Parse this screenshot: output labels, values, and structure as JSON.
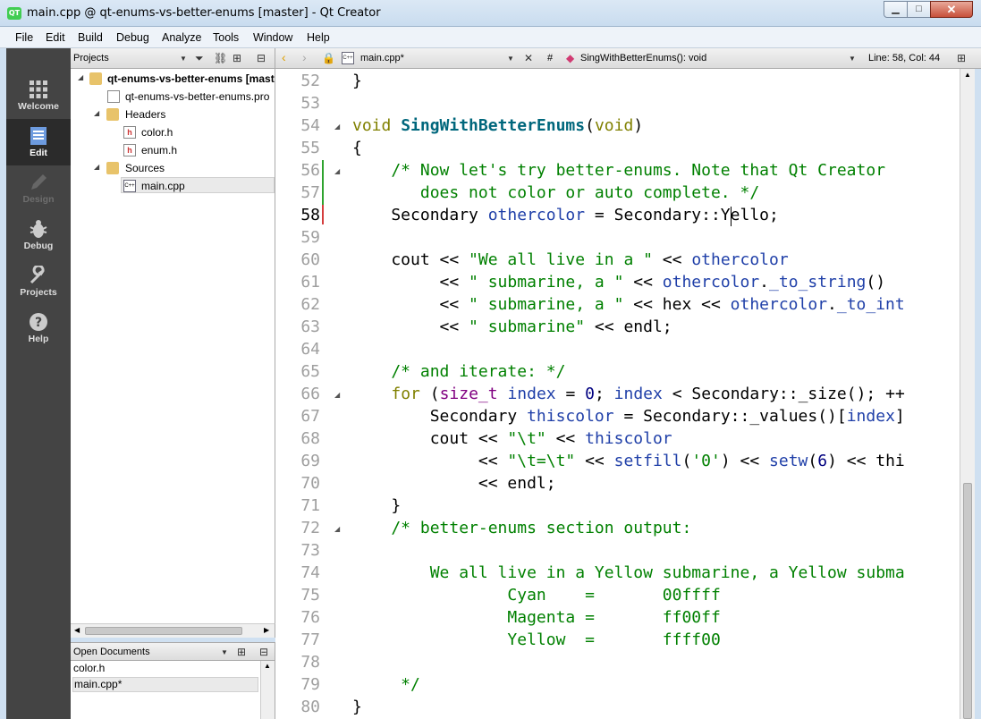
{
  "window": {
    "title": "main.cpp @ qt-enums-vs-better-enums [master] - Qt Creator",
    "app_icon": "QT",
    "controls": {
      "minimize": "▁",
      "maximize": "□",
      "close": "✕"
    }
  },
  "menu": [
    "File",
    "Edit",
    "Build",
    "Debug",
    "Analyze",
    "Tools",
    "Window",
    "Help"
  ],
  "modes": [
    {
      "label": "Welcome",
      "icon": "grid-icon"
    },
    {
      "label": "Edit",
      "icon": "document-icon",
      "active": true
    },
    {
      "label": "Design",
      "icon": "pencil-icon",
      "disabled": true
    },
    {
      "label": "Debug",
      "icon": "bug-icon"
    },
    {
      "label": "Projects",
      "icon": "wrench-icon"
    },
    {
      "label": "Help",
      "icon": "help-icon"
    }
  ],
  "projects_panel": {
    "title": "Projects",
    "tree": [
      {
        "label": "qt-enums-vs-better-enums [master]",
        "bold": true,
        "arrow": "◢",
        "icon": "project-folder-icon"
      },
      {
        "label": "qt-enums-vs-better-enums.pro",
        "icon": "pro-file-icon"
      },
      {
        "label": "Headers",
        "arrow": "◢",
        "icon": "headers-folder-icon"
      },
      {
        "label": "color.h",
        "icon": "header-file-icon"
      },
      {
        "label": "enum.h",
        "icon": "header-file-icon"
      },
      {
        "label": "Sources",
        "arrow": "◢",
        "icon": "sources-folder-icon"
      },
      {
        "label": "main.cpp",
        "icon": "cpp-file-icon",
        "selected": true
      }
    ]
  },
  "open_documents": {
    "title": "Open Documents",
    "items": [
      "color.h",
      "main.cpp*"
    ]
  },
  "editor": {
    "file_tab": "main.cpp*",
    "symbol": "SingWithBetterEnums(): void",
    "hash": "#",
    "position": "Line: 58, Col: 44",
    "current_line": 58,
    "lines": [
      {
        "n": "52",
        "text": "}"
      },
      {
        "n": "53",
        "text": ""
      },
      {
        "n": "54",
        "text": "void SingWithBetterEnums(void)",
        "fold": true
      },
      {
        "n": "55",
        "text": "{"
      },
      {
        "n": "56",
        "text": "    /* Now let's try better-enums. Note that Qt Creator",
        "fold": true
      },
      {
        "n": "57",
        "text": "       does not color or auto complete. */"
      },
      {
        "n": "58",
        "text": "    Secondary othercolor = Secondary::Yello;"
      },
      {
        "n": "59",
        "text": ""
      },
      {
        "n": "60",
        "text": "    cout << \"We all live in a \" << othercolor"
      },
      {
        "n": "61",
        "text": "         << \" submarine, a \" << othercolor._to_string()"
      },
      {
        "n": "62",
        "text": "         << \" submarine, a \" << hex << othercolor._to_int"
      },
      {
        "n": "63",
        "text": "         << \" submarine\" << endl;"
      },
      {
        "n": "64",
        "text": ""
      },
      {
        "n": "65",
        "text": "    /* and iterate: */"
      },
      {
        "n": "66",
        "text": "    for (size_t index = 0; index < Secondary::_size(); ++",
        "fold": true
      },
      {
        "n": "67",
        "text": "        Secondary thiscolor = Secondary::_values()[index]"
      },
      {
        "n": "68",
        "text": "        cout << \"\\t\" << thiscolor"
      },
      {
        "n": "69",
        "text": "             << \"\\t=\\t\" << setfill('0') << setw(6) << thi"
      },
      {
        "n": "70",
        "text": "             << endl;"
      },
      {
        "n": "71",
        "text": "    }"
      },
      {
        "n": "72",
        "text": "    /* better-enums section output:",
        "fold": true
      },
      {
        "n": "73",
        "text": ""
      },
      {
        "n": "74",
        "text": "        We all live in a Yellow submarine, a Yellow subma"
      },
      {
        "n": "75",
        "text": "                Cyan    =       00ffff"
      },
      {
        "n": "76",
        "text": "                Magenta =       ff00ff"
      },
      {
        "n": "77",
        "text": "                Yellow  =       ffff00"
      },
      {
        "n": "78",
        "text": ""
      },
      {
        "n": "79",
        "text": "     */"
      },
      {
        "n": "80",
        "text": "}"
      }
    ]
  },
  "colors": {
    "keyword": "#808000",
    "function": "#00677c",
    "type": "#800080",
    "string": "#008000",
    "comment": "#008000",
    "modebar": "#444444"
  }
}
